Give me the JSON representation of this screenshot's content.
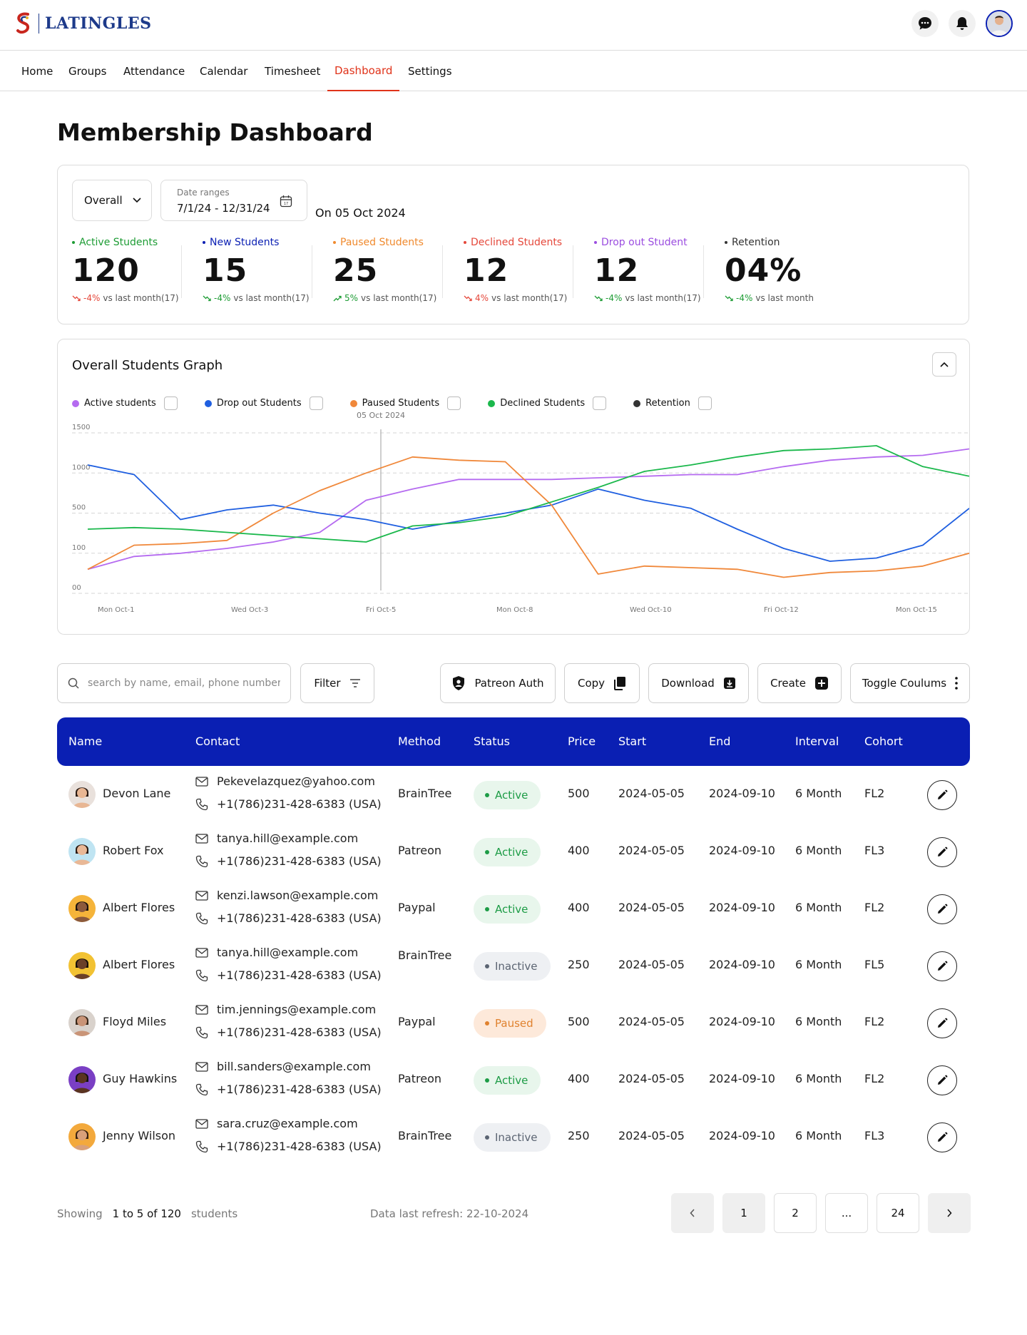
{
  "brand": {
    "name": "LATINGLES"
  },
  "header": {
    "icons": [
      "chat-icon",
      "bell-icon",
      "user-avatar"
    ]
  },
  "nav": {
    "items": [
      "Home",
      "Groups",
      "Attendance",
      "Calendar",
      "Timesheet",
      "Dashboard",
      "Settings"
    ],
    "active": "Dashboard"
  },
  "page": {
    "title": "Membership Dashboard"
  },
  "filters": {
    "scope": "Overall",
    "date_label": "Date ranges",
    "date_value": "7/1/24 - 12/31/24",
    "on_date": "On 05 Oct 2024"
  },
  "stats": [
    {
      "label": "Active Students",
      "value": "120",
      "delta": "-4%",
      "trend": "down",
      "suffix": "vs last month(17)",
      "color": "#1d9c34"
    },
    {
      "label": "New Students",
      "value": "15",
      "delta": "-4%",
      "trend": "down",
      "suffix": "vs last month(17)",
      "color": "#0a1fb3"
    },
    {
      "label": "Paused Students",
      "value": "25",
      "delta": "5%",
      "trend": "up",
      "suffix": "vs last month(17)",
      "color": "#f08a2e"
    },
    {
      "label": "Declined Students",
      "value": "12",
      "delta": "4%",
      "trend": "down",
      "suffix": "vs last month(17)",
      "color": "#e5483b"
    },
    {
      "label": "Drop out Student",
      "value": "12",
      "delta": "-4%",
      "trend": "down",
      "suffix": "vs last month(17)",
      "color": "#9b4de0"
    },
    {
      "label": "Retention",
      "value": "04%",
      "delta": "-4%",
      "trend": "down",
      "suffix": "vs last month",
      "color": "#333333"
    }
  ],
  "graph": {
    "title": "Overall Students Graph"
  },
  "chart_data": {
    "type": "line",
    "title": "Overall Students Graph",
    "y_tick_labels": [
      "00",
      "100",
      "500",
      "1000",
      "1500"
    ],
    "x_tick_labels": [
      "Mon Oct-1",
      "Wed Oct-3",
      "Fri Oct-5",
      "Mon Oct-8",
      "Wed Oct-10",
      "Fri Oct-12",
      "Mon Oct-15"
    ],
    "marker_label": "05 Oct 2024",
    "grid": true,
    "legend_position": "top-left",
    "series": [
      {
        "name": "Active students",
        "color": "#b56bf0",
        "values": [
          0.15,
          0.23,
          0.25,
          0.28,
          0.32,
          0.38,
          0.58,
          0.65,
          0.71,
          0.71,
          0.71,
          0.72,
          0.73,
          0.74,
          0.74,
          0.79,
          0.83,
          0.85,
          0.86,
          0.9
        ]
      },
      {
        "name": "Drop out Students",
        "color": "#1f5fe0",
        "values": [
          0.8,
          0.74,
          0.46,
          0.52,
          0.55,
          0.5,
          0.46,
          0.4,
          0.45,
          0.5,
          0.55,
          0.65,
          0.58,
          0.53,
          0.4,
          0.28,
          0.2,
          0.22,
          0.3,
          0.53
        ]
      },
      {
        "name": "Paused Students",
        "color": "#f0883a",
        "values": [
          0.15,
          0.3,
          0.31,
          0.33,
          0.5,
          0.64,
          0.75,
          0.85,
          0.83,
          0.82,
          0.55,
          0.12,
          0.17,
          0.16,
          0.15,
          0.1,
          0.13,
          0.14,
          0.17,
          0.25
        ]
      },
      {
        "name": "Declined Students",
        "color": "#1bb84c",
        "values": [
          0.4,
          0.41,
          0.4,
          0.38,
          0.36,
          0.34,
          0.32,
          0.42,
          0.44,
          0.48,
          0.57,
          0.66,
          0.76,
          0.8,
          0.85,
          0.89,
          0.9,
          0.92,
          0.79,
          0.73
        ]
      },
      {
        "name": "Retention",
        "color": "#333333",
        "values": []
      }
    ]
  },
  "toolbar": {
    "search_placeholder": "search by name, email, phone number",
    "filter": "Filter",
    "patreon": "Patreon Auth",
    "copy": "Copy",
    "download": "Download",
    "create": "Create",
    "toggle": "Toggle Coulums"
  },
  "table": {
    "headers": [
      "Name",
      "Contact",
      "Method",
      "Status",
      "Price",
      "Start",
      "End",
      "Interval",
      "Cohort"
    ],
    "rows": [
      {
        "name": "Devon Lane",
        "email": "Pekevelazquez@yahoo.com",
        "phone": "+1(786)231-428-6383 (USA)",
        "method": "BrainTree",
        "status": "Active",
        "price": "500",
        "start": "2024-05-05",
        "end": "2024-09-10",
        "interval": "6 Month",
        "cohort": "FL2"
      },
      {
        "name": "Robert Fox",
        "email": "tanya.hill@example.com",
        "phone": "+1(786)231-428-6383 (USA)",
        "method": "Patreon",
        "status": "Active",
        "price": "400",
        "start": "2024-05-05",
        "end": "2024-09-10",
        "interval": "6 Month",
        "cohort": "FL3"
      },
      {
        "name": "Albert Flores",
        "email": "kenzi.lawson@example.com",
        "phone": "+1(786)231-428-6383 (USA)",
        "method": "Paypal",
        "status": "Active",
        "price": "400",
        "start": "2024-05-05",
        "end": "2024-09-10",
        "interval": "6 Month",
        "cohort": "FL2"
      },
      {
        "name": "Albert Flores",
        "email": "tanya.hill@example.com",
        "phone": "+1(786)231-428-6383 (USA)",
        "method": "BrainTree",
        "status": "Inactive",
        "price": "250",
        "start": "2024-05-05",
        "end": "2024-09-10",
        "interval": "6 Month",
        "cohort": "FL5"
      },
      {
        "name": "Floyd Miles",
        "email": "tim.jennings@example.com",
        "phone": "+1(786)231-428-6383 (USA)",
        "method": "Paypal",
        "status": "Paused",
        "price": "500",
        "start": "2024-05-05",
        "end": "2024-09-10",
        "interval": "6 Month",
        "cohort": "FL2"
      },
      {
        "name": "Guy Hawkins",
        "email": "bill.sanders@example.com",
        "phone": "+1(786)231-428-6383 (USA)",
        "method": "Patreon",
        "status": "Active",
        "price": "400",
        "start": "2024-05-05",
        "end": "2024-09-10",
        "interval": "6 Month",
        "cohort": "FL2"
      },
      {
        "name": "Jenny Wilson",
        "email": "sara.cruz@example.com",
        "phone": "+1(786)231-428-6383 (USA)",
        "method": "BrainTree",
        "status": "Inactive",
        "price": "250",
        "start": "2024-05-05",
        "end": "2024-09-10",
        "interval": "6 Month",
        "cohort": "FL3"
      }
    ]
  },
  "footer": {
    "showing_prefix": "Showing",
    "showing_range": "1 to 5 of 120",
    "showing_suffix": "students",
    "refresh": "Data last refresh: 22-10-2024",
    "pages": [
      "1",
      "2",
      "...",
      "24"
    ]
  }
}
